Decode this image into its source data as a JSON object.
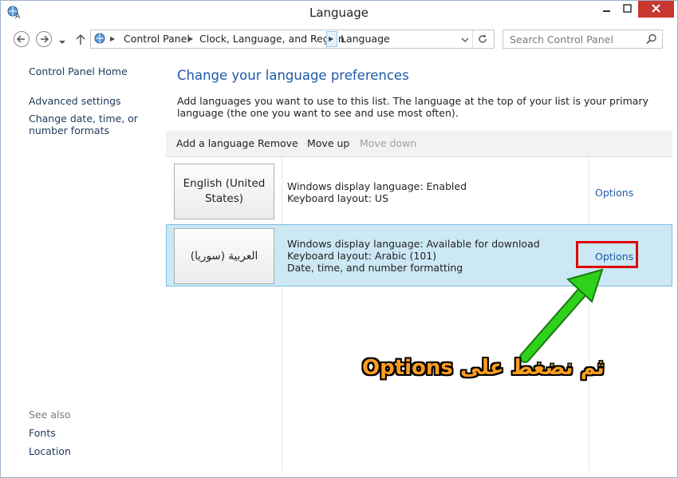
{
  "window": {
    "title": "Language"
  },
  "address": {
    "crumbs": [
      "Control Panel",
      "Clock, Language, and Region",
      "Language"
    ]
  },
  "search": {
    "placeholder": "Search Control Panel"
  },
  "sidebar": {
    "home": "Control Panel Home",
    "links": [
      "Advanced settings",
      "Change date, time, or number formats"
    ],
    "see_also_label": "See also",
    "see_also": [
      "Fonts",
      "Location"
    ]
  },
  "main": {
    "heading": "Change your language preferences",
    "description": "Add languages you want to use to this list. The language at the top of your list is your primary language (the one you want to see and use most often).",
    "toolbar": {
      "add": "Add a language",
      "remove": "Remove",
      "move_up": "Move up",
      "move_down": "Move down"
    },
    "languages": [
      {
        "name": "English (United States)",
        "details": [
          "Windows display language: Enabled",
          "Keyboard layout: US"
        ],
        "options": "Options"
      },
      {
        "name": "العربية (سوريا)",
        "details": [
          "Windows display language: Available for download",
          "Keyboard layout: Arabic (101)",
          "Date, time, and number formatting"
        ],
        "options": "Options"
      }
    ]
  },
  "annotation": {
    "text": "ثم نضغط على Options"
  },
  "colors": {
    "link": "#1e5aa8",
    "selected_row": "#cce8f4",
    "highlight": "#e00000",
    "arrow": "#2fd11a",
    "annotation": "#ff9d1e"
  }
}
